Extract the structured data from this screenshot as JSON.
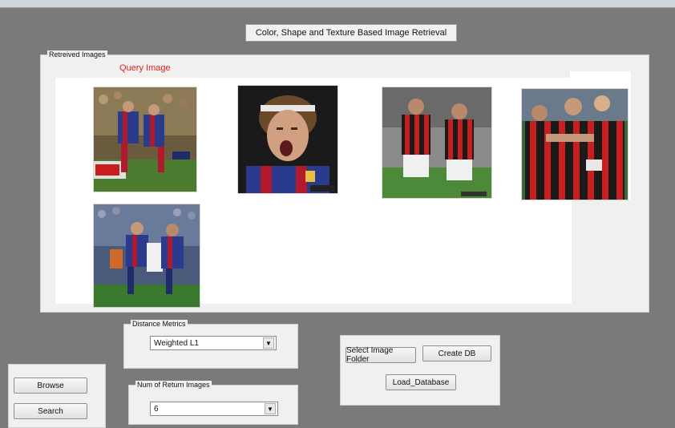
{
  "app": {
    "title": "Color, Shape and Texture Based Image Retrieval"
  },
  "results": {
    "group_title": "Retreived Images",
    "query_label": "Query Image",
    "images": [
      {
        "name": "query-image",
        "subject": "players in blue and red kit tackling"
      },
      {
        "name": "result-image-1",
        "subject": "player with headband shouting"
      },
      {
        "name": "result-image-2",
        "subject": "players in red and black striped kit"
      },
      {
        "name": "result-image-3",
        "subject": "players in red and black kit celebrating"
      },
      {
        "name": "result-image-4",
        "subject": "players in blue and red kit challenging"
      }
    ]
  },
  "distance": {
    "group_title": "Distance Metrics",
    "selected": "Weighted L1"
  },
  "num_return": {
    "group_title": "Num of Return Images",
    "selected": "6"
  },
  "database": {
    "select_folder_label": "Select Image Folder",
    "create_db_label": "Create DB",
    "load_db_label": "Load_Database"
  },
  "side": {
    "browse_label": "Browse",
    "search_label": "Search"
  },
  "icons": {
    "dropdown": "dropdown-arrow-icon"
  }
}
